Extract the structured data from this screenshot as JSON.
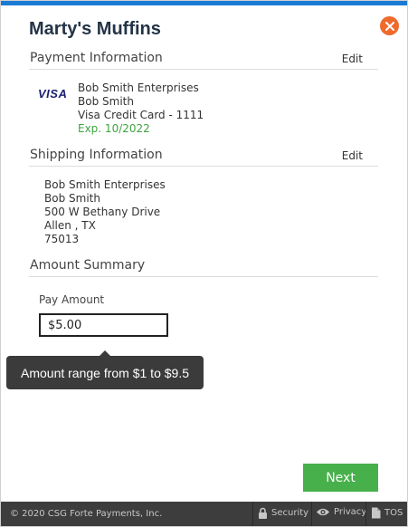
{
  "header": {
    "title": "Marty's Muffins",
    "close_icon": "close-icon"
  },
  "payment": {
    "section_title": "Payment Information",
    "edit_label": "Edit",
    "card_brand_logo": "VISA",
    "company": "Bob Smith Enterprises",
    "name": "Bob Smith",
    "card_description": "Visa Credit Card - 1111",
    "expiration": "Exp. 10/2022"
  },
  "shipping": {
    "section_title": "Shipping Information",
    "edit_label": "Edit",
    "company": "Bob Smith Enterprises",
    "name": "Bob Smith",
    "street": "500 W Bethany Drive",
    "city_state": "Allen , TX",
    "zip": "75013"
  },
  "amount": {
    "section_title": "Amount Summary",
    "pay_label": "Pay Amount",
    "pay_value": "$5.00",
    "tooltip": "Amount range from $1 to $9.5"
  },
  "actions": {
    "next_label": "Next"
  },
  "footer": {
    "copyright": "© 2020 CSG Forte Payments, Inc.",
    "links": [
      {
        "label": "Security",
        "icon": "lock-icon"
      },
      {
        "label": "Privacy",
        "icon": "eye-icon"
      },
      {
        "label": "TOS",
        "icon": "document-icon"
      }
    ]
  },
  "colors": {
    "top_bar": "#1a7ad4",
    "close_button": "#ef6a2b",
    "next_button": "#47b04b",
    "expiration_text": "#3fa33f",
    "footer_bg": "#3d3d3d",
    "tooltip_bg": "#3b3b3b"
  }
}
